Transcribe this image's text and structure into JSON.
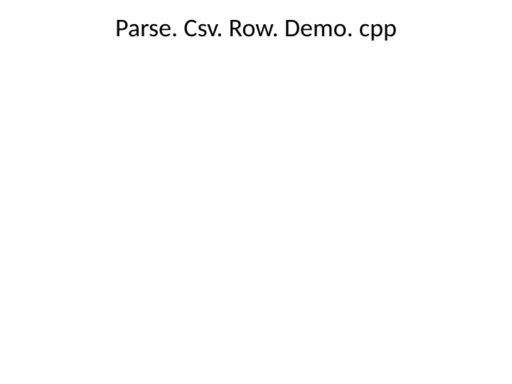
{
  "slide": {
    "title": "Parse. Csv. Row. Demo. cpp"
  }
}
